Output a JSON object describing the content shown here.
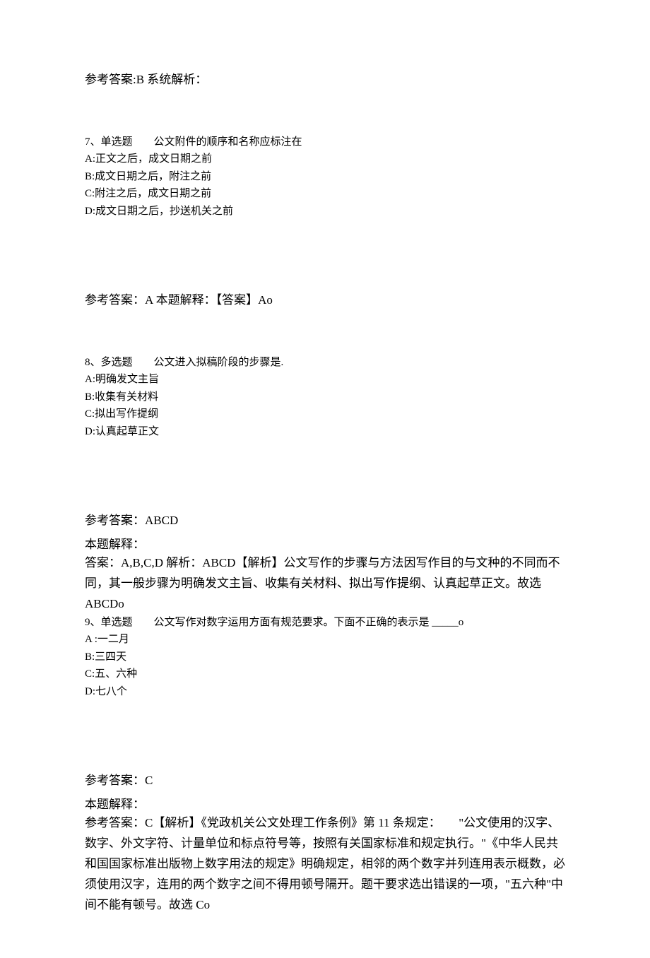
{
  "q6": {
    "answer_line": "参考答案:B 系统解析："
  },
  "q7": {
    "header": "7、单选题　　公文附件的顺序和名称应标注在",
    "optA": "A:正文之后，成文日期之前",
    "optB": "B:成文日期之后，附注之前",
    "optC": "C:附注之后，成文日期之前",
    "optD": "D:成文日期之后，抄送机关之前",
    "answer_line": "参考答案：A 本题解释：【答案】Ao"
  },
  "q8": {
    "header": "8、多选题　　公文进入拟稿阶段的步骤是.",
    "optA": "A:明确发文主旨",
    "optB": "B:收集有关材料",
    "optC": "C:拟出写作提纲",
    "optD": "D:认真起草正文",
    "answer_line": "参考答案：ABCD",
    "explain_head": "本题解释：",
    "explain_body": "答案：A,B,C,D 解析：ABCD【解析】公文写作的步骤与方法因写作目的与文种的不同而不同，其一般步骤为明确发文主旨、收集有关材料、拟出写作提纲、认真起草正文。故选 ABCDo"
  },
  "q9": {
    "header": "9、单选题　　公文写作对数字运用方面有规范要求。下面不正确的表示是 _____o",
    "optA": " A :一二月",
    "optB": "B:三四天",
    "optC": "C:五、六种",
    "optD": "D:七八个",
    "answer_line": "参考答案：C",
    "explain_head": "本题解释：",
    "explain_body": "参考答案：C【解析】《党政机关公文处理工作条例》第 11 条规定：　　\"公文使用的汉字、数字、外文字符、计量单位和标点符号等，按照有关国家标准和规定执行。\"《中华人民共和国国家标准出版物上数字用法的规定》明确规定，相邻的两个数字并列连用表示概数，必须使用汉字，连用的两个数字之间不得用顿号隔开。题干要求选出错误的一项，\"五六种\"中间不能有顿号。故选 Co"
  }
}
